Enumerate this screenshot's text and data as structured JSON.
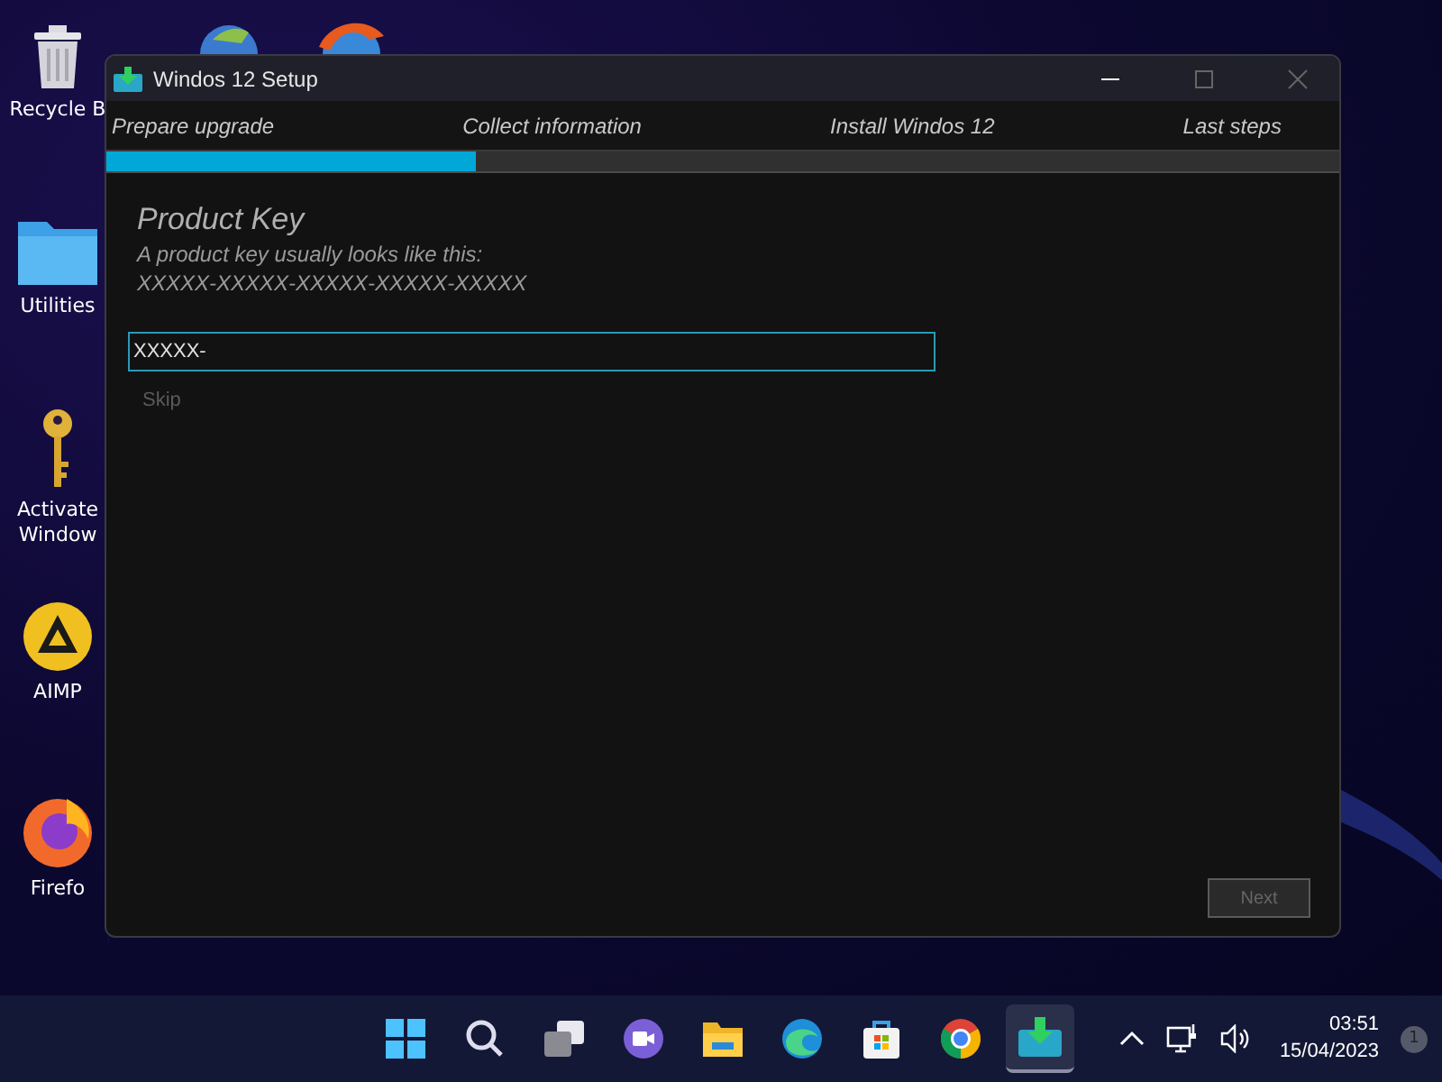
{
  "desktop_icons": [
    {
      "kind": "bin",
      "label": "Recycle B"
    },
    {
      "kind": "folder",
      "label": "Utilities"
    },
    {
      "kind": "key",
      "label": "Activate Window"
    },
    {
      "kind": "aimp",
      "label": "AIMP"
    },
    {
      "kind": "firefox",
      "label": "Firefo"
    }
  ],
  "window": {
    "title": "Windos 12 Setup",
    "steps": [
      {
        "label": "Prepare upgrade"
      },
      {
        "label": "Collect information"
      },
      {
        "label": "Install Windos 12"
      },
      {
        "label": "Last steps"
      }
    ],
    "progress": {
      "level": 0.3
    },
    "heading": "Product Key",
    "hint": "A product key usually looks like this:",
    "format": "XXXXX-XXXXX-XXXXX-XXXXX-XXXXX",
    "key_field": {
      "value": "XXXXX-"
    },
    "skip": {
      "label": "Skip",
      "disabled": true
    },
    "next": {
      "label": "Next",
      "disabled": true
    }
  },
  "taskbar": {
    "apps": [
      {
        "kind": "start",
        "selected": false
      },
      {
        "kind": "search",
        "selected": false
      },
      {
        "kind": "taskview",
        "selected": false
      },
      {
        "kind": "chat",
        "selected": false
      },
      {
        "kind": "explorer",
        "selected": false
      },
      {
        "kind": "edge",
        "selected": false
      },
      {
        "kind": "store",
        "selected": false
      },
      {
        "kind": "chrome",
        "selected": false
      },
      {
        "kind": "setup",
        "selected": true
      }
    ],
    "time": "03:51",
    "date": "15/04/2023",
    "notifications": "1"
  }
}
